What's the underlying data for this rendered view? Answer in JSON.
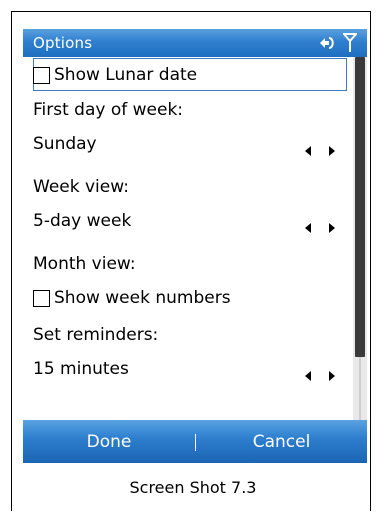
{
  "screen": {
    "title": "Options",
    "status_icons": [
      "connectivity-icon",
      "signal-icon"
    ]
  },
  "options": {
    "show_lunar_date": {
      "label": "Show Lunar date",
      "checked": false
    },
    "first_day_of_week": {
      "label": "First day of week:",
      "value": "Sunday"
    },
    "week_view": {
      "label": "Week view:",
      "value": "5-day week"
    },
    "month_view": {
      "label": "Month view:"
    },
    "show_week_numbers": {
      "label": "Show week numbers",
      "checked": false
    },
    "set_reminders": {
      "label": "Set reminders:",
      "value": "15 minutes"
    }
  },
  "softkeys": {
    "left": "Done",
    "right": "Cancel"
  },
  "caption": "Screen Shot 7.3",
  "colors": {
    "titlebar": "#2f7fcf",
    "softbar": "#1f6fc1",
    "focus_border": "#3b7cc3"
  }
}
